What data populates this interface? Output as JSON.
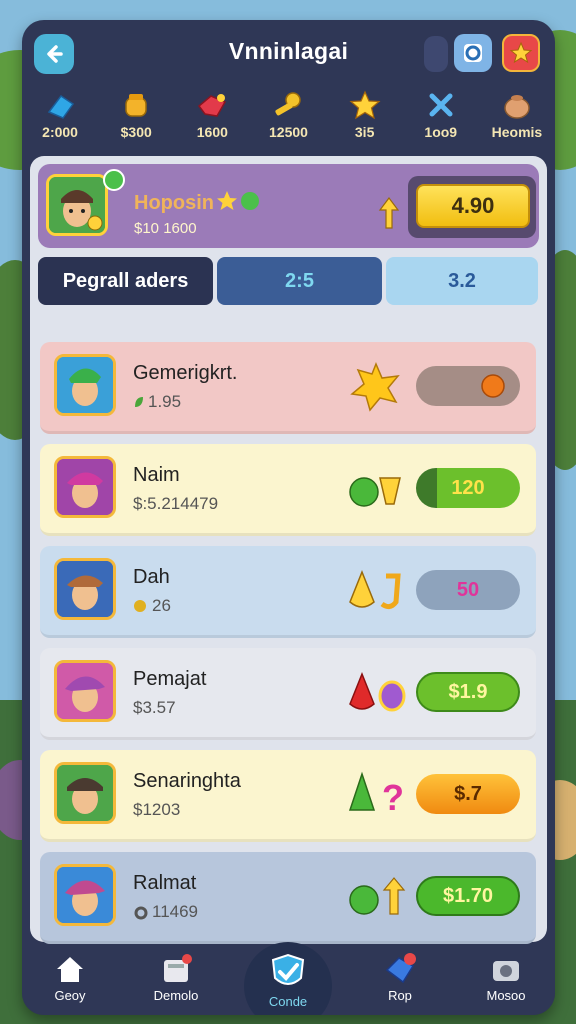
{
  "header": {
    "title": "Vnninlagai"
  },
  "resources": [
    {
      "icon": "blue-gem-icon",
      "value": "2:000"
    },
    {
      "icon": "honey-pot-icon",
      "value": "$300"
    },
    {
      "icon": "red-gem-icon",
      "value": "1600"
    },
    {
      "icon": "key-icon",
      "value": "12500"
    },
    {
      "icon": "star-icon",
      "value": "3i5"
    },
    {
      "icon": "crossed-swords-icon",
      "value": "1oo9"
    },
    {
      "icon": "treasure-bag-icon",
      "value": "Heomis"
    }
  ],
  "hero": {
    "name": "Hoposin",
    "sub": "$10 1600",
    "price": "4.90"
  },
  "tabs": [
    {
      "label": "Pegrall aders"
    },
    {
      "label": "2:5"
    },
    {
      "label": "3.2"
    }
  ],
  "rows": [
    {
      "name": "Gemerigkrt.",
      "sub": "1.95",
      "price": "",
      "bg": "#f2c8c6",
      "pill_bg": "#a58d86"
    },
    {
      "name": "Naim",
      "sub": "$:5.214479",
      "price": "120",
      "bg": "#fbf5cf",
      "pill_bg": "#5ea63b"
    },
    {
      "name": "Dah",
      "sub": "26",
      "price": "50",
      "bg": "#c9dcee",
      "pill_bg": "#8ea3bc"
    },
    {
      "name": "Pemajat",
      "sub": "$3.57",
      "price": "$1.9",
      "bg": "#e6e8ee",
      "pill_bg": "#6cc02c"
    },
    {
      "name": "Senaringhta",
      "sub": "$1203",
      "price": "$.7",
      "bg": "#fbf5cf",
      "pill_bg": "#f7a21c"
    },
    {
      "name": "Ralmat",
      "sub": "11469",
      "price": "$1.70",
      "bg": "#b7c6dc",
      "pill_bg": "#4bb82c"
    }
  ],
  "nav": [
    {
      "label": "Geoy",
      "icon": "home-icon"
    },
    {
      "label": "Demolo",
      "icon": "mailbox-icon"
    },
    {
      "label": "Conde",
      "icon": "shield-check-icon"
    },
    {
      "label": "Rop",
      "icon": "gem-bag-icon"
    },
    {
      "label": "Mosoo",
      "icon": "camera-icon"
    }
  ]
}
